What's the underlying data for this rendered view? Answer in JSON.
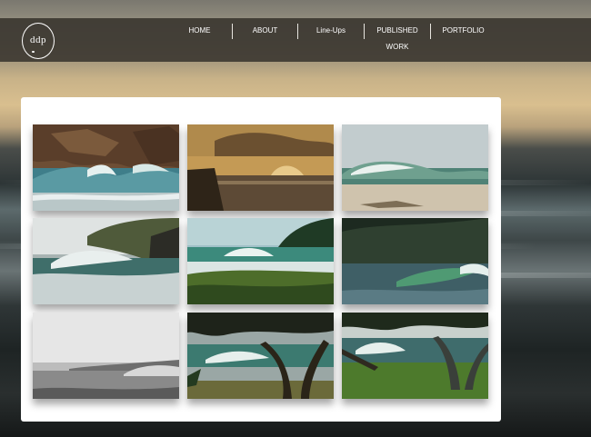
{
  "site": {
    "logo_text": "ddp"
  },
  "nav": {
    "items": [
      {
        "label": "HOME"
      },
      {
        "label": "ABOUT"
      },
      {
        "label": "Line-Ups"
      },
      {
        "label": "PUBLISHED WORK"
      },
      {
        "label": "PORTFOLIO"
      }
    ]
  },
  "gallery": {
    "photos": [
      {
        "subject": "wave-below-cliffs"
      },
      {
        "subject": "golden-hour-wave"
      },
      {
        "subject": "beach-wave-sand"
      },
      {
        "subject": "wave-beside-headland"
      },
      {
        "subject": "wave-with-grass-foreground"
      },
      {
        "subject": "green-barrel-dark-forest"
      },
      {
        "subject": "black-and-white-lineup"
      },
      {
        "subject": "wave-through-tree"
      },
      {
        "subject": "wave-behind-tree-lawn"
      }
    ]
  },
  "colors": {
    "nav_bg": "#3e3a32",
    "panel_bg": "#ffffff",
    "nav_text": "#ffffff"
  }
}
